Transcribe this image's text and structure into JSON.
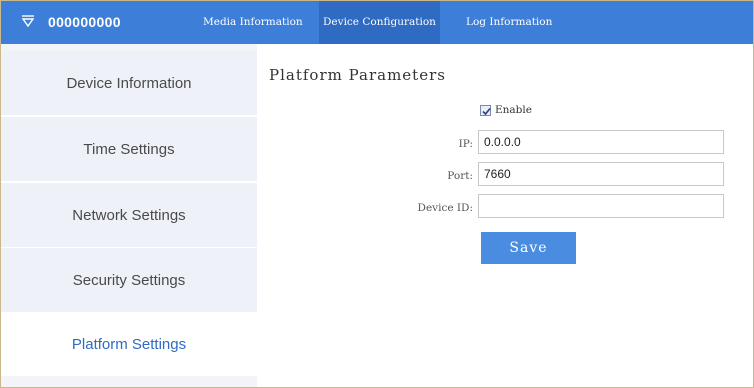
{
  "colors": {
    "accent": "#3d7fd8",
    "active_sidebar_text": "#2f6ac3",
    "save_button": "#4a8ce0"
  },
  "header": {
    "device_icon": "filter-triangle-icon",
    "device_name": "000000000",
    "tabs": [
      {
        "label": "Media Information",
        "active": false
      },
      {
        "label": "Device Configuration",
        "active": true
      },
      {
        "label": "Log Information",
        "active": false
      }
    ]
  },
  "sidebar": {
    "items": [
      {
        "label": "Device Information",
        "active": false
      },
      {
        "label": "Time Settings",
        "active": false
      },
      {
        "label": "Network Settings",
        "active": false
      },
      {
        "label": "Security Settings",
        "active": false
      },
      {
        "label": "Platform Settings",
        "active": true
      }
    ]
  },
  "main": {
    "title": "Platform Parameters",
    "enable": {
      "label": "Enable",
      "checked": true
    },
    "fields": {
      "ip": {
        "label": "IP:",
        "value": "0.0.0.0"
      },
      "port": {
        "label": "Port:",
        "value": "7660"
      },
      "device_id": {
        "label": "Device ID:",
        "value": ""
      }
    },
    "save_label": "Save"
  }
}
